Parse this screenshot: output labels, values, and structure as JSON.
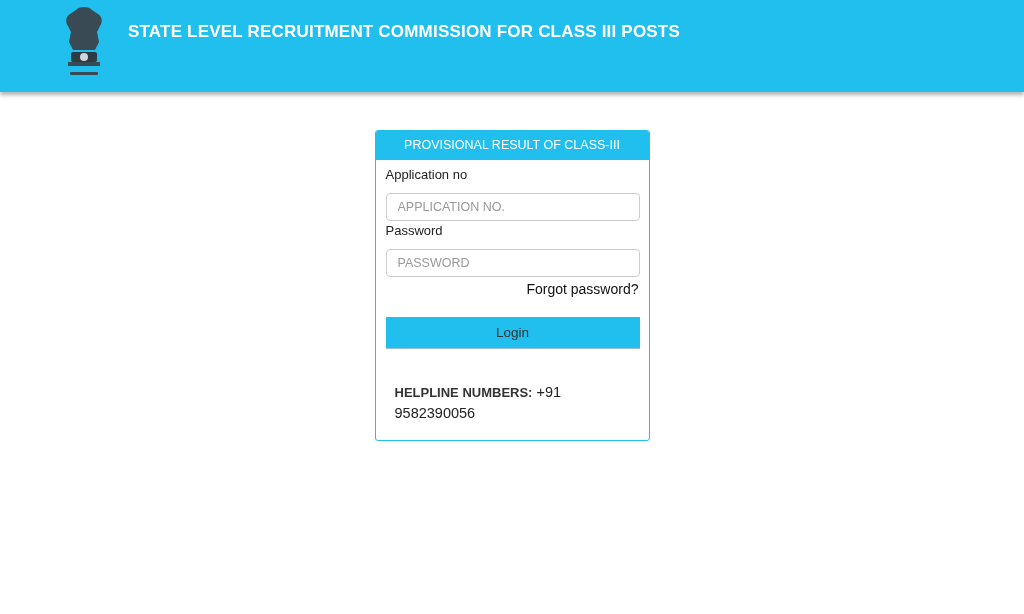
{
  "header": {
    "title": "STATE LEVEL RECRUITMENT COMMISSION FOR CLASS III POSTS"
  },
  "login_card": {
    "title": "PROVISIONAL RESULT OF CLASS-III",
    "fields": [
      {
        "label": "Application no",
        "placeholder": "APPLICATION NO."
      },
      {
        "label": "Password",
        "placeholder": "PASSWORD"
      }
    ],
    "forgot_link": "Forgot password?",
    "login_button": "Login",
    "helpline": "**HELPLINE NUMBERS:** +91 9582390056"
  }
}
